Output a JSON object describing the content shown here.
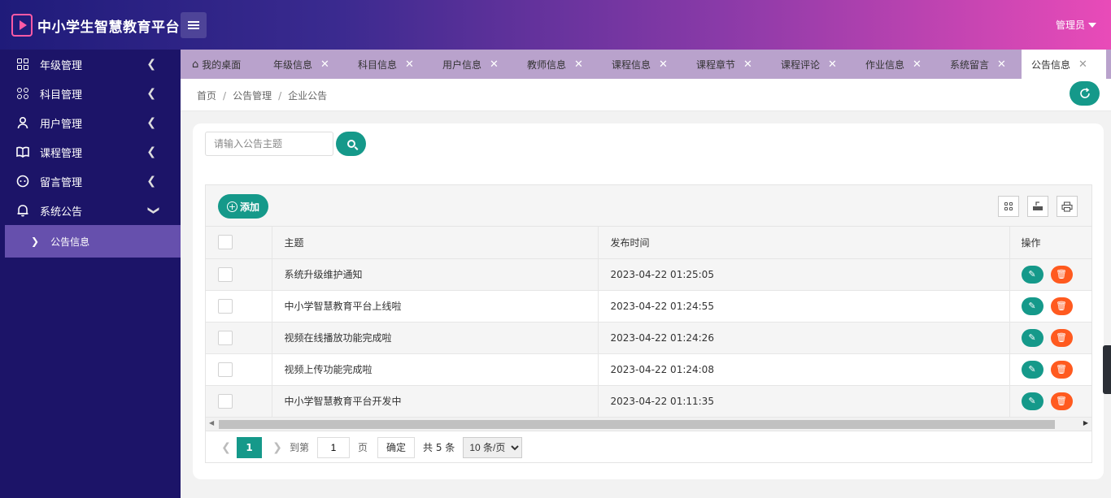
{
  "header": {
    "title": "中小学生智慧教育平台",
    "user": "管理员"
  },
  "sidebar": {
    "items": [
      {
        "label": "年级管理",
        "icon": "grid-icon"
      },
      {
        "label": "科目管理",
        "icon": "apps-icon"
      },
      {
        "label": "用户管理",
        "icon": "user-icon"
      },
      {
        "label": "课程管理",
        "icon": "book-icon"
      },
      {
        "label": "留言管理",
        "icon": "message-icon"
      },
      {
        "label": "系统公告",
        "icon": "bell-icon"
      }
    ],
    "sub_item": "公告信息"
  },
  "tabs": [
    {
      "label": "我的桌面"
    },
    {
      "label": "年级信息"
    },
    {
      "label": "科目信息"
    },
    {
      "label": "用户信息"
    },
    {
      "label": "教师信息"
    },
    {
      "label": "课程信息"
    },
    {
      "label": "课程章节"
    },
    {
      "label": "课程评论"
    },
    {
      "label": "作业信息"
    },
    {
      "label": "系统留言"
    },
    {
      "label": "公告信息"
    }
  ],
  "breadcrumb": [
    "首页",
    "公告管理",
    "企业公告"
  ],
  "search": {
    "placeholder": "请输入公告主题",
    "value": ""
  },
  "toolbar": {
    "add_label": "添加"
  },
  "table": {
    "headers": {
      "subject": "主题",
      "time": "发布时间",
      "ops": "操作"
    },
    "rows": [
      {
        "subject": "系统升级维护通知",
        "time": "2023-04-22 01:25:05"
      },
      {
        "subject": "中小学智慧教育平台上线啦",
        "time": "2023-04-22 01:24:55"
      },
      {
        "subject": "视频在线播放功能完成啦",
        "time": "2023-04-22 01:24:26"
      },
      {
        "subject": "视频上传功能完成啦",
        "time": "2023-04-22 01:24:08"
      },
      {
        "subject": "中小学智慧教育平台开发中",
        "time": "2023-04-22 01:11:35"
      }
    ]
  },
  "pager": {
    "current": "1",
    "goto_label": "到第",
    "goto_value": "1",
    "page_label": "页",
    "ok_label": "确定",
    "total_label": "共 5 条",
    "size_label": "10 条/页"
  },
  "colors": {
    "accent": "#15998a",
    "danger": "#ff5a1f",
    "sidebar": "#1c1468"
  }
}
